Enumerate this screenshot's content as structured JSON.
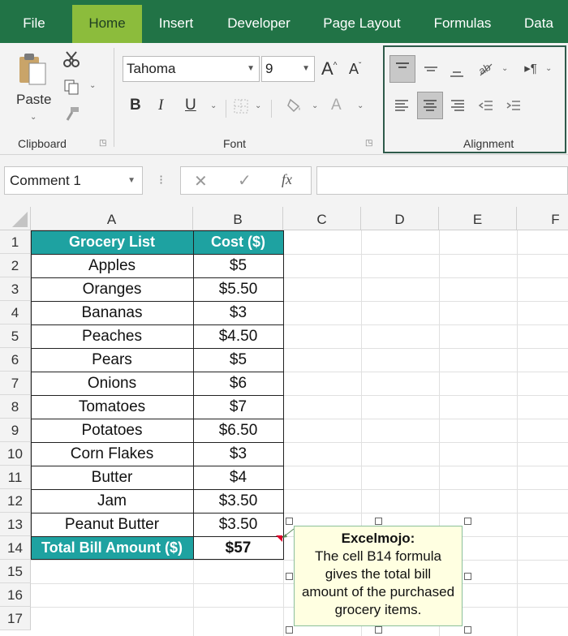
{
  "menu": {
    "tabs": [
      "File",
      "Home",
      "Insert",
      "Developer",
      "Page Layout",
      "Formulas",
      "Data"
    ],
    "active": "Home"
  },
  "ribbon": {
    "clipboard": {
      "paste_label": "Paste",
      "group_label": "Clipboard"
    },
    "font": {
      "font_name": "Tahoma",
      "font_size": "9",
      "bold": "B",
      "italic": "I",
      "underline": "U",
      "grow": "A",
      "shrink": "A",
      "font_color": "A",
      "group_label": "Font"
    },
    "alignment": {
      "group_label": "Alignment"
    }
  },
  "formula_bar": {
    "name_box": "Comment 1",
    "cancel": "✕",
    "enter": "✓",
    "fx": "fx",
    "formula": ""
  },
  "sheet": {
    "columns": [
      "A",
      "B",
      "C",
      "D",
      "E",
      "F"
    ],
    "rows": [
      "1",
      "2",
      "3",
      "4",
      "5",
      "6",
      "7",
      "8",
      "9",
      "10",
      "11",
      "12",
      "13",
      "14",
      "15",
      "16",
      "17"
    ],
    "table": {
      "headers": [
        "Grocery List",
        "Cost ($)"
      ],
      "items": [
        [
          "Apples",
          "$5"
        ],
        [
          "Oranges",
          "$5.50"
        ],
        [
          "Bananas",
          "$3"
        ],
        [
          "Peaches",
          "$4.50"
        ],
        [
          "Pears",
          "$5"
        ],
        [
          "Onions",
          "$6"
        ],
        [
          "Tomatoes",
          "$7"
        ],
        [
          "Potatoes",
          "$6.50"
        ],
        [
          "Corn Flakes",
          "$3"
        ],
        [
          "Butter",
          "$4"
        ],
        [
          "Jam",
          "$3.50"
        ],
        [
          "Peanut Butter",
          "$3.50"
        ]
      ],
      "total_label": "Total Bill Amount ($)",
      "total_value": "$57"
    },
    "comment": {
      "author": "Excelmojo:",
      "lines": [
        "The cell B14 formula",
        "gives the total bill",
        "amount of the purchased",
        "grocery items."
      ]
    }
  },
  "colors": {
    "menu_bg": "#217346",
    "active_tab": "#8cbc3c",
    "table_header": "#1ea2a1",
    "comment_bg": "#ffffe1",
    "comment_indicator": "#e0002a"
  }
}
